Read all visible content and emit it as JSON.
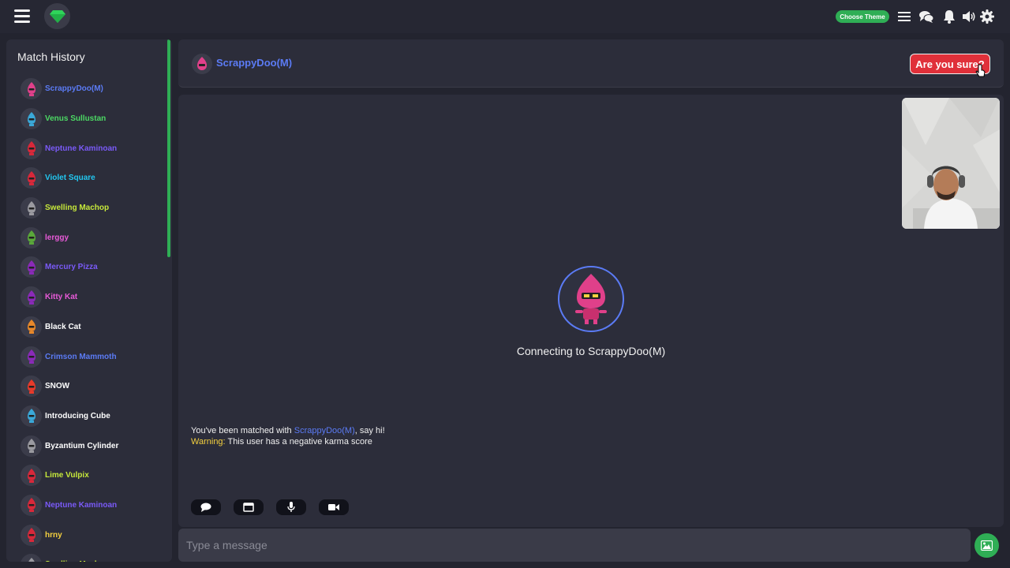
{
  "topbar": {
    "theme_button_label": "Choose Theme",
    "icons": [
      "menu-icon",
      "gem-logo-icon",
      "list-icon",
      "chat-bubbles-icon",
      "bell-icon",
      "volume-icon",
      "settings-icon"
    ]
  },
  "sidebar": {
    "title": "Match History",
    "items": [
      {
        "name": "ScrappyDoo(M)",
        "color": "#5b7bf5",
        "avatar_color": "#e0408a"
      },
      {
        "name": "Venus Sullustan",
        "color": "#4cd964",
        "avatar_color": "#3aa8d8"
      },
      {
        "name": "Neptune Kaminoan",
        "color": "#7a5af8",
        "avatar_color": "#d8283a"
      },
      {
        "name": "Violet Square",
        "color": "#22c7f0",
        "avatar_color": "#d8283a"
      },
      {
        "name": "Swelling Machop",
        "color": "#c6e83a",
        "avatar_color": "#9a9aa0"
      },
      {
        "name": "lerggy",
        "color": "#e85ad8",
        "avatar_color": "#5aa83a"
      },
      {
        "name": "Mercury Pizza",
        "color": "#7a5af8",
        "avatar_color": "#8a2ab8"
      },
      {
        "name": "Kitty Kat",
        "color": "#e85ad8",
        "avatar_color": "#8a2ab8"
      },
      {
        "name": "Black Cat",
        "color": "#ffffff",
        "avatar_color": "#e8882a"
      },
      {
        "name": "Crimson Mammoth",
        "color": "#5b7bf5",
        "avatar_color": "#8a2ab8"
      },
      {
        "name": "SNOW",
        "color": "#ffffff",
        "avatar_color": "#e83a2a"
      },
      {
        "name": "Introducing Cube",
        "color": "#ffffff",
        "avatar_color": "#3aa8d8"
      },
      {
        "name": "Byzantium Cylinder",
        "color": "#ffffff",
        "avatar_color": "#9a9aa0"
      },
      {
        "name": "Lime Vulpix",
        "color": "#c6e83a",
        "avatar_color": "#d8283a"
      },
      {
        "name": "Neptune Kaminoan",
        "color": "#7a5af8",
        "avatar_color": "#d8283a"
      },
      {
        "name": "hrny",
        "color": "#f4d03f",
        "avatar_color": "#d8283a"
      },
      {
        "name": "Swelling Machop",
        "color": "#c6e83a",
        "avatar_color": "#9a9aa0"
      }
    ]
  },
  "header": {
    "name": "ScrappyDoo(M)",
    "end_button": "Are you sure?"
  },
  "video": {
    "connecting_text": "Connecting to ScrappyDoo(M)"
  },
  "system": {
    "matched_prefix": "You've been matched with",
    "matched_name": "ScrappyDoo(M)",
    "matched_suffix": ", say hi!",
    "warning_label": "Warning:",
    "warning_text": "This user has a negative karma score"
  },
  "controls": [
    "chat-icon",
    "window-icon",
    "mic-icon",
    "camera-icon"
  ],
  "input": {
    "placeholder": "Type a message"
  },
  "colors": {
    "accent_green": "#2fae55",
    "accent_blue": "#5b7bf5",
    "danger": "#e0303a",
    "warning": "#f4d03f"
  }
}
